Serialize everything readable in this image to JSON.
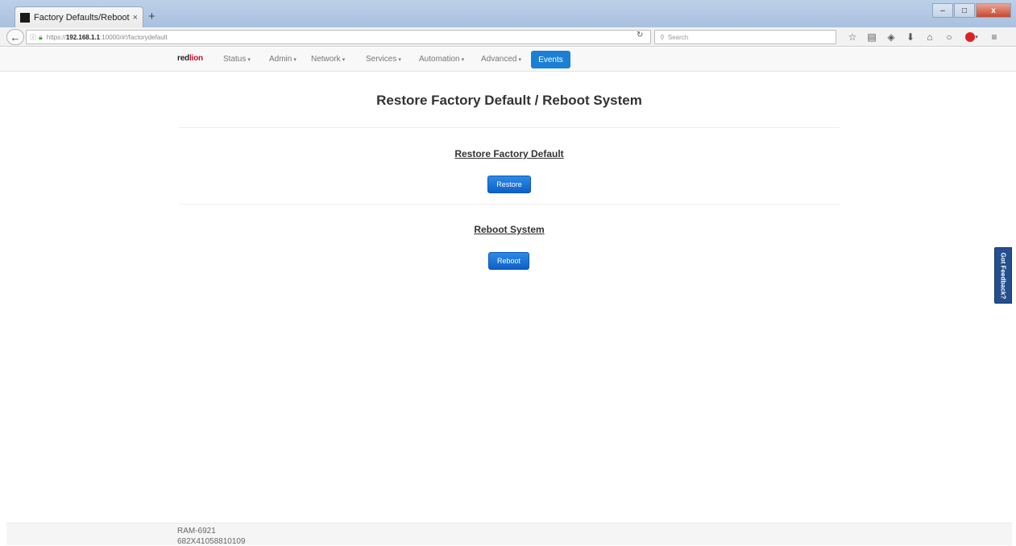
{
  "browser": {
    "tab_title": "Factory Defaults/Reboot - ...",
    "tab_close": "×",
    "new_tab": "+",
    "url_prefix": "https://",
    "url_host": "192.168.1.1",
    "url_path": ":10000/#!/factorydefault",
    "search_placeholder": "Search",
    "window_controls": {
      "minimize": "–",
      "maximize": "□",
      "close": "x"
    }
  },
  "appnav": {
    "logo_part1": "red",
    "logo_part2": "lion",
    "items": [
      {
        "label": "Status"
      },
      {
        "label": "Admin"
      },
      {
        "label": "Network"
      },
      {
        "label": "Services"
      },
      {
        "label": "Automation"
      },
      {
        "label": "Advanced"
      }
    ],
    "caret": "▾",
    "events_label": "Events"
  },
  "main": {
    "title": "Restore Factory Default / Reboot System",
    "restore_section": {
      "heading": "Restore Factory Default",
      "button": "Restore"
    },
    "reboot_section": {
      "heading": "Reboot System",
      "button": "Reboot"
    }
  },
  "feedback_label": "Got Feedback?",
  "footer": {
    "model": "RAM-6921",
    "serial": "682X41058810109"
  },
  "colors": {
    "accent": "#1b7fd6",
    "brand_red": "#c8102e",
    "feedback_bg": "#234f8f"
  }
}
